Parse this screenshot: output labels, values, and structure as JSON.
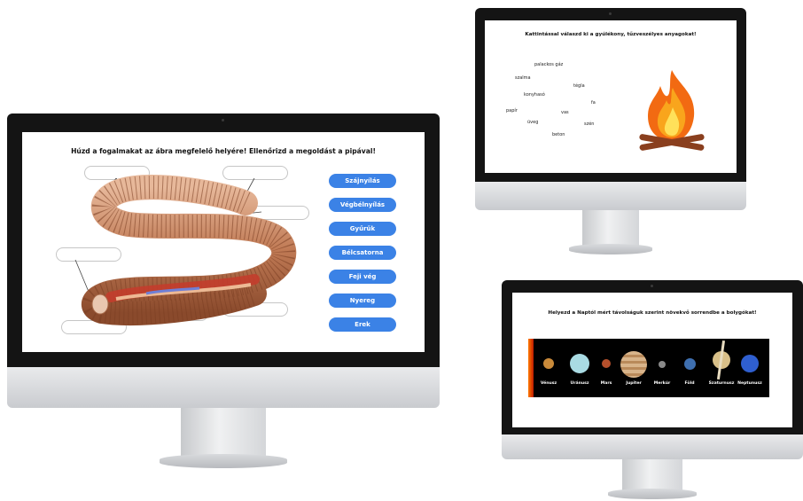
{
  "worm_exercise": {
    "instruction": "Húzd a fogalmakat az ábra megfelelő helyére! Ellenőrizd a megoldást a pipával!",
    "terms": [
      "Szájnyílás",
      "Végbélnyílás",
      "Gyűrűk",
      "Bélcsatorna",
      "Feji vég",
      "Nyereg",
      "Erek"
    ],
    "accent_color": "#3b82e6"
  },
  "fire_exercise": {
    "instruction": "Kattintással válaszd ki a gyúlékony, tűzveszélyes anyagokat!",
    "words": [
      "palackos gáz",
      "szalma",
      "tégla",
      "konyhasó",
      "fa",
      "papír",
      "vas",
      "üveg",
      "szén",
      "beton"
    ]
  },
  "planet_exercise": {
    "instruction": "Helyezd a Naptól mért távolságuk szerint növekvő sorrendbe a bolygókat!",
    "planets": [
      {
        "name": "Vénusz",
        "color": "#c98a3a"
      },
      {
        "name": "Uránusz",
        "color": "#a9dbe3"
      },
      {
        "name": "Mars",
        "color": "#b5502c"
      },
      {
        "name": "Jupiter",
        "color": "#d8b48a"
      },
      {
        "name": "Merkúr",
        "color": "#8a8a8a"
      },
      {
        "name": "Föld",
        "color": "#3e6fb0"
      },
      {
        "name": "Szaturnusz",
        "color": "#d9c089"
      },
      {
        "name": "Neptunusz",
        "color": "#2f5fd0"
      }
    ]
  }
}
